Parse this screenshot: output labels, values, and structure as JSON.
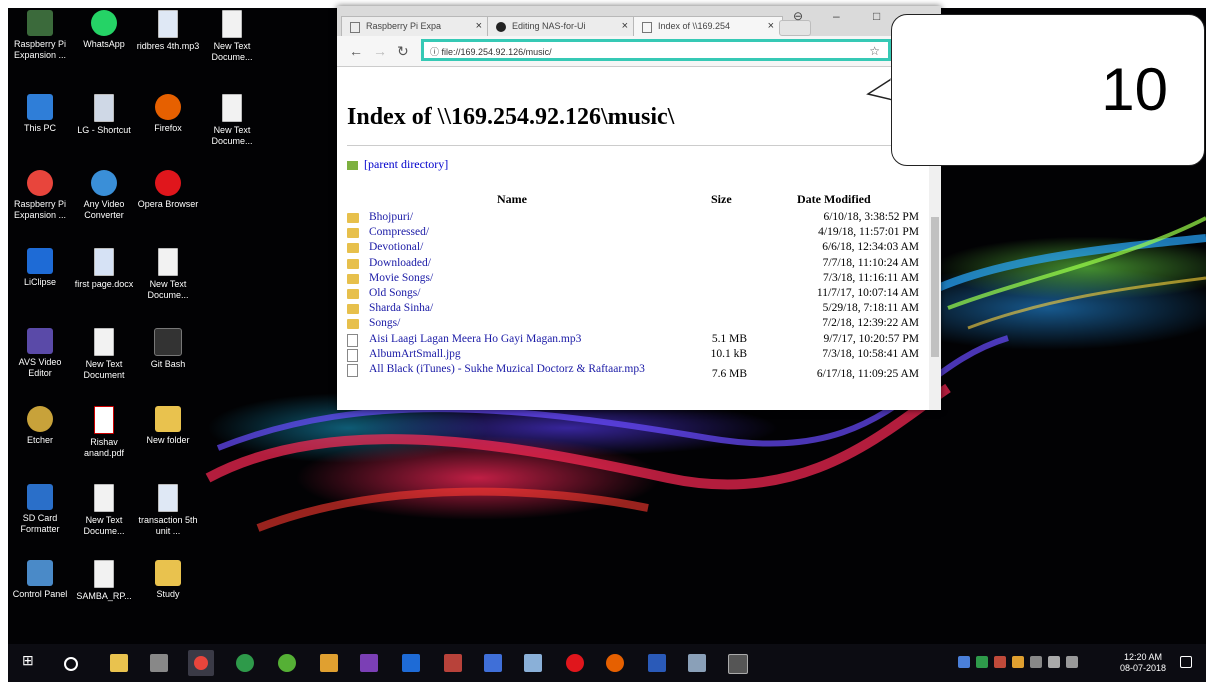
{
  "desktop": {
    "icons": [
      {
        "label": "Raspberry Pi Expansion ...",
        "icon": "raspberry-icon"
      },
      {
        "label": "WhatsApp",
        "icon": "whatsapp-icon"
      },
      {
        "label": "ridbres 4th.mp3",
        "icon": "audio-file-icon"
      },
      {
        "label": "New Text Docume...",
        "icon": "text-file-icon"
      },
      {
        "label": "This PC",
        "icon": "computer-icon"
      },
      {
        "label": "LG - Shortcut",
        "icon": "shortcut-icon"
      },
      {
        "label": "Firefox",
        "icon": "firefox-icon"
      },
      {
        "label": "New Text Docume...",
        "icon": "text-file-icon"
      },
      {
        "label": "Raspberry Pi Expansion ...",
        "icon": "chrome-icon"
      },
      {
        "label": "Any Video Converter",
        "icon": "video-converter-icon"
      },
      {
        "label": "Opera Browser",
        "icon": "opera-icon"
      },
      {
        "label": "LiClipse",
        "icon": "liclipse-icon"
      },
      {
        "label": "first page.docx",
        "icon": "word-doc-icon"
      },
      {
        "label": "New Text Docume...",
        "icon": "text-file-icon"
      },
      {
        "label": "AVS Video Editor",
        "icon": "video-editor-icon"
      },
      {
        "label": "New Text Document",
        "icon": "text-file-icon"
      },
      {
        "label": "Git Bash",
        "icon": "git-icon"
      },
      {
        "label": "Etcher",
        "icon": "etcher-icon"
      },
      {
        "label": "Rishav anand.pdf",
        "icon": "pdf-icon"
      },
      {
        "label": "New folder",
        "icon": "folder-icon"
      },
      {
        "label": "SD Card Formatter",
        "icon": "sd-card-icon"
      },
      {
        "label": "New Text Docume...",
        "icon": "text-file-icon"
      },
      {
        "label": "transaction 5th unit ...",
        "icon": "audio-file-icon"
      },
      {
        "label": "Control Panel",
        "icon": "control-panel-icon"
      },
      {
        "label": "SAMBA_RP...",
        "icon": "text-file-icon"
      },
      {
        "label": "Study",
        "icon": "folder-icon"
      }
    ]
  },
  "browser": {
    "tabs": [
      {
        "label": "Raspberry Pi Expa",
        "close": "×"
      },
      {
        "label": "Editing NAS-for-Ui",
        "close": "×"
      },
      {
        "label": "Index of \\\\169.254",
        "close": "×"
      }
    ],
    "address": "file://169.254.92.126/music/",
    "page": {
      "title": "Index of \\\\169.254.92.126\\music\\",
      "parent_link": "[parent directory]",
      "columns": {
        "name": "Name",
        "size": "Size",
        "date": "Date Modified"
      },
      "rows": [
        {
          "name": "Bhojpuri/",
          "size": "",
          "date": "6/10/18, 3:38:52 PM",
          "type": "folder"
        },
        {
          "name": "Compressed/",
          "size": "",
          "date": "4/19/18, 11:57:01 PM",
          "type": "folder"
        },
        {
          "name": "Devotional/",
          "size": "",
          "date": "6/6/18, 12:34:03 AM",
          "type": "folder"
        },
        {
          "name": "Downloaded/",
          "size": "",
          "date": "7/7/18, 11:10:24 AM",
          "type": "folder"
        },
        {
          "name": "Movie Songs/",
          "size": "",
          "date": "7/3/18, 11:16:11 AM",
          "type": "folder"
        },
        {
          "name": "Old Songs/",
          "size": "",
          "date": "11/7/17, 10:07:14 AM",
          "type": "folder"
        },
        {
          "name": "Sharda Sinha/",
          "size": "",
          "date": "5/29/18, 7:18:11 AM",
          "type": "folder"
        },
        {
          "name": "Songs/",
          "size": "",
          "date": "7/2/18, 12:39:22 AM",
          "type": "folder"
        },
        {
          "name": "Aisi Laagi Lagan Meera Ho Gayi Magan.mp3",
          "size": "5.1 MB",
          "date": "9/7/17, 10:20:57 PM",
          "type": "file"
        },
        {
          "name": "AlbumArtSmall.jpg",
          "size": "10.1 kB",
          "date": "7/3/18, 10:58:41 AM",
          "type": "file"
        },
        {
          "name": "All Black (iTunes) - Sukhe Muzical Doctorz & Raftaar.mp3",
          "size": "7.6 MB",
          "date": "6/17/18, 11:09:25 AM",
          "type": "file"
        }
      ]
    }
  },
  "callout": {
    "number": "10"
  },
  "taskbar": {
    "clock_time": "12:20 AM",
    "clock_date": "08-07-2018"
  }
}
